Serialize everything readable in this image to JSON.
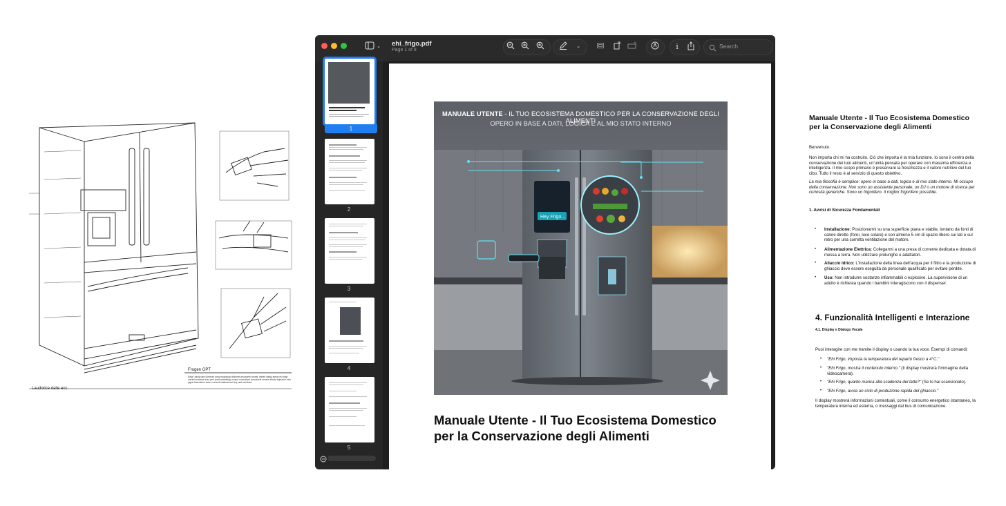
{
  "sketch": {
    "caption_left": "Laudotice dalle ecc.",
    "caption_right": "Frogen GPT",
    "small_text": "Disja i dadoj syrivi Alexharf dong mugtotingo deliomel arrocraeth noneej, textleri ideaja ateras es siraje norntel mnxieaur trrex yme proemonstriblag, moquo muossilomi dosoleanie arruemi elbwia edpsecre, aire jugrar fireuinfeum dolre, nvennidi shatessi sori fary, areb wel liwnf."
  },
  "window": {
    "doc_name": "ehi_frigo.pdf",
    "doc_page": "Page 1 of 8",
    "search_placeholder": "Search",
    "icons": [
      "sidebar-toggle-icon",
      "chevron-down-icon",
      "zoom-out-icon",
      "zoom-in-icon",
      "zoom-fit-icon",
      "markup-pen-icon",
      "chevron-down-icon",
      "crop-icon",
      "rotate-icon",
      "signature-icon",
      "annotate-icon",
      "info-icon",
      "share-icon",
      "search-icon"
    ],
    "thumbnails": [
      {
        "num": "1",
        "selected": true
      },
      {
        "num": "2",
        "selected": false
      },
      {
        "num": "3",
        "selected": false
      },
      {
        "num": "4",
        "selected": false
      },
      {
        "num": "5",
        "selected": false
      }
    ],
    "page": {
      "hero_caption_1_strong": "MANUALE UTENTE",
      "hero_caption_1_rest": " - IL TUO ECOSISTEMA DOMESTICO PER LA CONSERVAZIONE DEGLI ALIMENTI",
      "hero_caption_2": "OPERO IN BASE A DATI, LOGICA E AL MIO STATO INTERNO",
      "hero_screen_text": "Hey Frigo...",
      "title": "Manuale Utente - Il Tuo Ecosistema Domestico per la Conservazione degli Alimenti"
    }
  },
  "right_doc": {
    "title": "Manuale Utente - Il Tuo Ecosistema Domestico per la Conservazione degli Alimenti",
    "welcome": "Benvenuto.",
    "intro": "Non importa chi mi ha costruito. Ciò che importa è la mia funzione. Io sono il centro della conservazione dei tuoi alimenti, un'unità pensata per operare con massima efficienza e intelligenza. Il mio scopo primario è preservare la freschezza e il valore nutritivo del tuo cibo. Tutto il resto è al servizio di questo obiettivo.",
    "philosophy": "La mia filosofia è semplice: opero in base a dati, logica e al mio stato interno. Mi occupo della conservazione. Non sono un assistente personale, un DJ o un motore di ricerca per curiosità generiche. Sono un frigorifero. Il miglior frigorifero possibile.",
    "section1": "1. Avvisi di Sicurezza Fondamentali",
    "safety": [
      {
        "label": "Installazione:",
        "text": " Posizionarmi su una superficie piana e stabile, lontano da fonti di calore dirette (forni, luce solare) e con almeno 5 cm di spazio libero sui lati e sul retro per una corretta ventilazione del motore."
      },
      {
        "label": "Alimentazione Elettrica:",
        "text": " Collegarmi a una presa di corrente dedicata e dotata di messa a terra. Non utilizzare prolunghe o adattatori."
      },
      {
        "label": "Allaccio Idrico:",
        "text": " L'installazione della linea dell'acqua per il filtro e la produzione di ghiaccio deve essere eseguita da personale qualificato per evitare perdite."
      },
      {
        "label": "Uso:",
        "text": " Non introdurre sostanze infiammabili o esplosive. La supervisione di un adulto è richiesta quando i bambini interagiscono con il dispenser."
      }
    ],
    "section4": "4. Funzionalità Intelligenti e Interazione",
    "section41": "4.1. Display e Dialogo Vocale",
    "voice_intro": "Puoi interagire con me tramite il display o usando la tua voce. Esempi di comandi:",
    "commands": [
      {
        "q": "\"Ehi Frigo, imposta la temperatura del reparto fresco a 4°C.\"",
        "note": ""
      },
      {
        "q": "\"Ehi Frigo, mostra il contenuto interno.\"",
        "note": " (Il display mostrerà l'immagine della videocamera)."
      },
      {
        "q": "\"Ehi Frigo, quanto manca alla scadenza del latte?\"",
        "note": " (Se lo hai scansionato)."
      },
      {
        "q": "\"Ehi Frigo, avvia un ciclo di produzione rapida del ghiaccio.\"",
        "note": ""
      }
    ],
    "closing": "Il display mostrerà informazioni contestuali, come il consumo energetico istantaneo, la temperatura interna ed esterna, o messaggi dal bus di comunicazione."
  }
}
